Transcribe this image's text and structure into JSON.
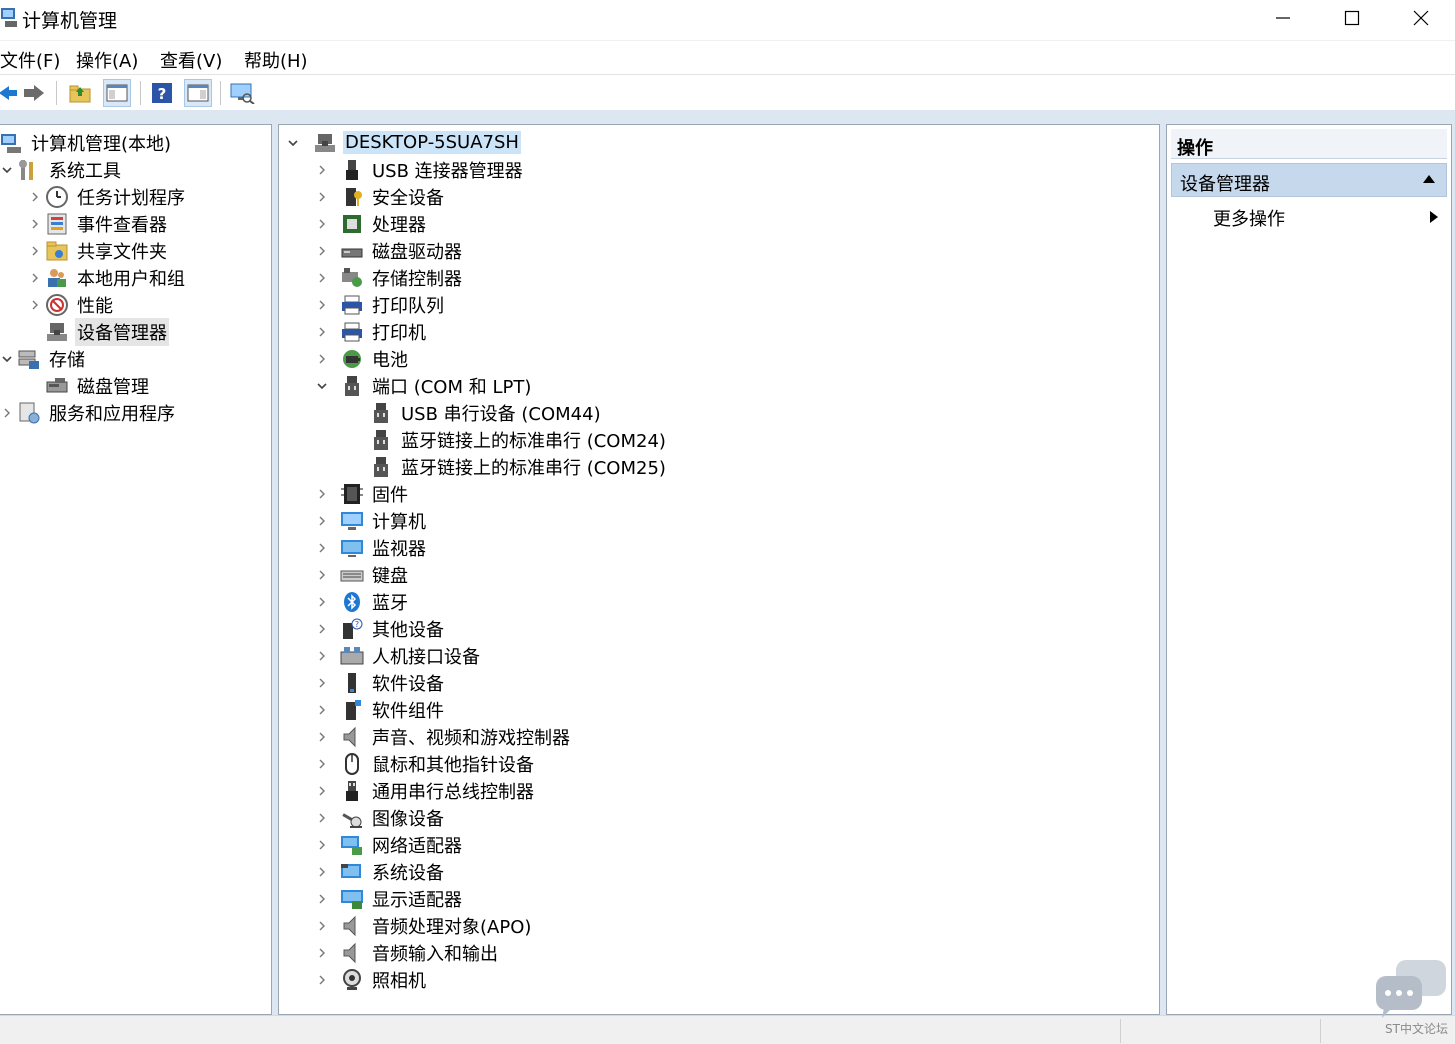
{
  "window": {
    "title": "计算机管理"
  },
  "menu": [
    "文件(F)",
    "操作(A)",
    "查看(V)",
    "帮助(H)"
  ],
  "left_tree": [
    {
      "label": "计算机管理(本地)",
      "icon": "computer-management-icon",
      "level": 0,
      "expander": ""
    },
    {
      "label": "系统工具",
      "icon": "system-tools-icon",
      "level": 1,
      "expander": "v"
    },
    {
      "label": "任务计划程序",
      "icon": "clock-icon",
      "level": 2,
      "expander": ">"
    },
    {
      "label": "事件查看器",
      "icon": "event-viewer-icon",
      "level": 2,
      "expander": ">"
    },
    {
      "label": "共享文件夹",
      "icon": "shared-folder-icon",
      "level": 2,
      "expander": ">"
    },
    {
      "label": "本地用户和组",
      "icon": "users-icon",
      "level": 2,
      "expander": ">"
    },
    {
      "label": "性能",
      "icon": "performance-icon",
      "level": 2,
      "expander": ">"
    },
    {
      "label": "设备管理器",
      "icon": "device-manager-icon",
      "level": 2,
      "expander": "",
      "selected": true
    },
    {
      "label": "存储",
      "icon": "storage-icon",
      "level": 1,
      "expander": "v"
    },
    {
      "label": "磁盘管理",
      "icon": "disk-management-icon",
      "level": 2,
      "expander": ""
    },
    {
      "label": "服务和应用程序",
      "icon": "services-icon",
      "level": 1,
      "expander": ">"
    }
  ],
  "device_tree": {
    "root": "DESKTOP-5SUA7SH",
    "items": [
      {
        "label": "USB 连接器管理器",
        "icon": "usb-connector-icon",
        "level": 1,
        "expander": ">"
      },
      {
        "label": "安全设备",
        "icon": "security-device-icon",
        "level": 1,
        "expander": ">"
      },
      {
        "label": "处理器",
        "icon": "processor-icon",
        "level": 1,
        "expander": ">"
      },
      {
        "label": "磁盘驱动器",
        "icon": "disk-drive-icon",
        "level": 1,
        "expander": ">"
      },
      {
        "label": "存储控制器",
        "icon": "storage-controller-icon",
        "level": 1,
        "expander": ">"
      },
      {
        "label": "打印队列",
        "icon": "print-queue-icon",
        "level": 1,
        "expander": ">"
      },
      {
        "label": "打印机",
        "icon": "printer-icon",
        "level": 1,
        "expander": ">"
      },
      {
        "label": "电池",
        "icon": "battery-icon",
        "level": 1,
        "expander": ">"
      },
      {
        "label": "端口 (COM 和 LPT)",
        "icon": "port-icon",
        "level": 1,
        "expander": "v"
      },
      {
        "label": "USB 串行设备 (COM44)",
        "icon": "port-icon",
        "level": 2,
        "expander": ""
      },
      {
        "label": "蓝牙链接上的标准串行 (COM24)",
        "icon": "port-icon",
        "level": 2,
        "expander": ""
      },
      {
        "label": "蓝牙链接上的标准串行 (COM25)",
        "icon": "port-icon",
        "level": 2,
        "expander": ""
      },
      {
        "label": "固件",
        "icon": "firmware-icon",
        "level": 1,
        "expander": ">"
      },
      {
        "label": "计算机",
        "icon": "computer-icon",
        "level": 1,
        "expander": ">"
      },
      {
        "label": "监视器",
        "icon": "monitor-icon",
        "level": 1,
        "expander": ">"
      },
      {
        "label": "键盘",
        "icon": "keyboard-icon",
        "level": 1,
        "expander": ">"
      },
      {
        "label": "蓝牙",
        "icon": "bluetooth-icon",
        "level": 1,
        "expander": ">"
      },
      {
        "label": "其他设备",
        "icon": "other-devices-icon",
        "level": 1,
        "expander": ">"
      },
      {
        "label": "人机接口设备",
        "icon": "hid-icon",
        "level": 1,
        "expander": ">"
      },
      {
        "label": "软件设备",
        "icon": "software-device-icon",
        "level": 1,
        "expander": ">"
      },
      {
        "label": "软件组件",
        "icon": "software-component-icon",
        "level": 1,
        "expander": ">"
      },
      {
        "label": "声音、视频和游戏控制器",
        "icon": "speaker-icon",
        "level": 1,
        "expander": ">"
      },
      {
        "label": "鼠标和其他指针设备",
        "icon": "mouse-icon",
        "level": 1,
        "expander": ">"
      },
      {
        "label": "通用串行总线控制器",
        "icon": "usb-controller-icon",
        "level": 1,
        "expander": ">"
      },
      {
        "label": "图像设备",
        "icon": "imaging-device-icon",
        "level": 1,
        "expander": ">"
      },
      {
        "label": "网络适配器",
        "icon": "network-adapter-icon",
        "level": 1,
        "expander": ">"
      },
      {
        "label": "系统设备",
        "icon": "system-devices-icon",
        "level": 1,
        "expander": ">"
      },
      {
        "label": "显示适配器",
        "icon": "display-adapter-icon",
        "level": 1,
        "expander": ">"
      },
      {
        "label": "音频处理对象(APO)",
        "icon": "speaker-icon",
        "level": 1,
        "expander": ">"
      },
      {
        "label": "音频输入和输出",
        "icon": "speaker-icon",
        "level": 1,
        "expander": ">"
      },
      {
        "label": "照相机",
        "icon": "camera-icon",
        "level": 1,
        "expander": ">"
      }
    ]
  },
  "actions": {
    "header": "操作",
    "section": "设备管理器",
    "item": "更多操作"
  },
  "watermark": "ST中文论坛",
  "colors": {
    "selection_blue": "#cce4f7",
    "action_section": "#c5d8ec",
    "frame": "#dde7f2"
  }
}
